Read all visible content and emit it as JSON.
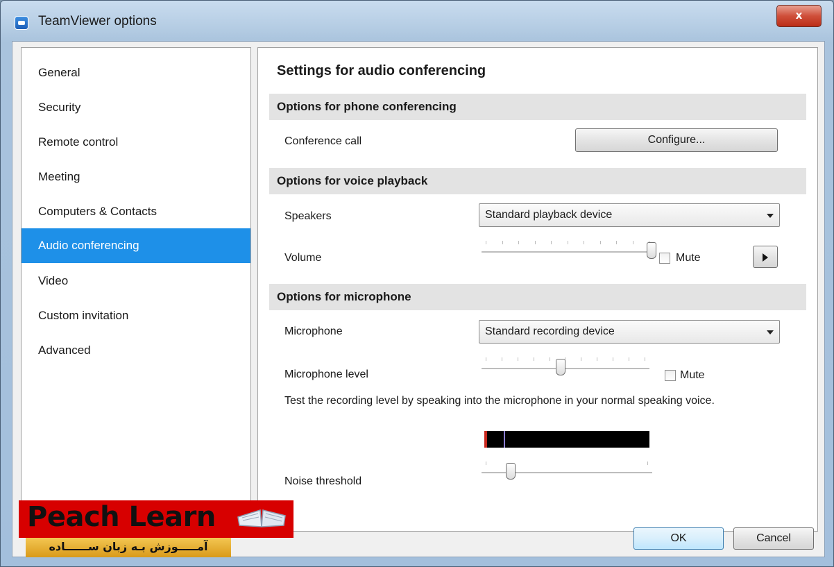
{
  "window": {
    "title": "TeamViewer options",
    "close_glyph": "x"
  },
  "sidebar": {
    "items": [
      {
        "label": "General"
      },
      {
        "label": "Security"
      },
      {
        "label": "Remote control"
      },
      {
        "label": "Meeting"
      },
      {
        "label": "Computers & Contacts"
      },
      {
        "label": "Audio conferencing"
      },
      {
        "label": "Video"
      },
      {
        "label": "Custom invitation"
      },
      {
        "label": "Advanced"
      }
    ],
    "selected": "Audio conferencing"
  },
  "panel": {
    "title": "Settings for audio conferencing",
    "phone": {
      "header": "Options for phone conferencing",
      "conference_call_label": "Conference call",
      "configure_button": "Configure..."
    },
    "playback": {
      "header": "Options for voice playback",
      "speakers_label": "Speakers",
      "speakers_value": "Standard playback device",
      "volume_label": "Volume",
      "volume_level": 1.0,
      "mute_label": "Mute",
      "mute_checked": false
    },
    "microphone": {
      "header": "Options for microphone",
      "microphone_label": "Microphone",
      "microphone_value": "Standard recording device",
      "level_label": "Microphone level",
      "level_value": 0.47,
      "mute_label": "Mute",
      "mute_checked": false,
      "test_hint": "Test the recording level by speaking into the microphone in your normal speaking voice.",
      "noise_label": "Noise threshold",
      "noise_value": 0.15
    }
  },
  "footer": {
    "ok_label": "OK",
    "cancel_label": "Cancel"
  },
  "watermark": {
    "brand": "Peach Learn",
    "tagline": "آمـــــوزش بـه زبان ســــــاده"
  },
  "colors": {
    "selection": "#1e90e8",
    "close_button": "#cf4f3a",
    "logo_red": "#d70000",
    "logo_gold": "#e8b236"
  }
}
